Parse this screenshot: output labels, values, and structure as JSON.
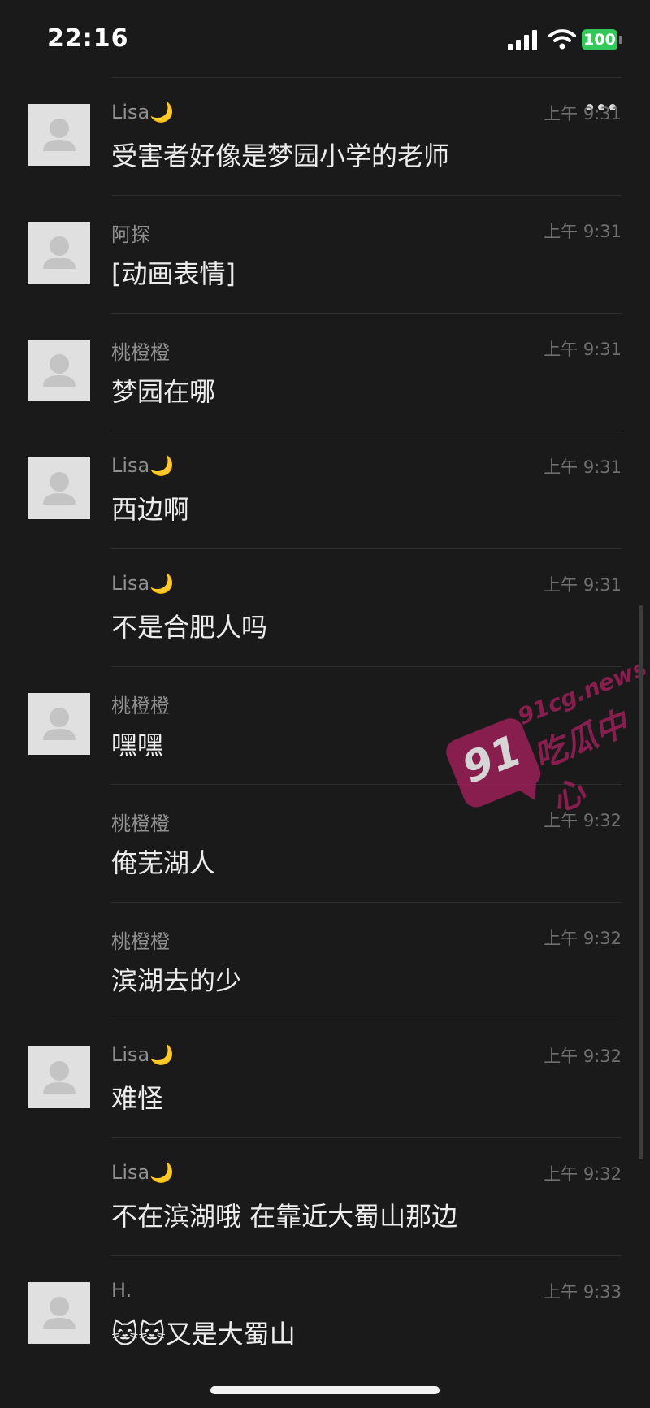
{
  "status_bar": {
    "time": "22:16",
    "battery": "100"
  },
  "chat": {
    "messages": [
      {
        "name": "Lisa🌙",
        "time": "上午 9:31",
        "text": "受害者好像是梦园小学的老师",
        "avatar": true
      },
      {
        "name": "阿探",
        "time": "上午 9:31",
        "text": "[动画表情]",
        "avatar": true
      },
      {
        "name": "桃橙橙",
        "time": "上午 9:31",
        "text": "梦园在哪",
        "avatar": true
      },
      {
        "name": "Lisa🌙",
        "time": "上午 9:31",
        "text": "西边啊",
        "avatar": true
      },
      {
        "name": "Lisa🌙",
        "time": "上午 9:31",
        "text": "不是合肥人吗",
        "avatar": false
      },
      {
        "name": "桃橙橙",
        "time": "",
        "text": "嘿嘿",
        "avatar": true
      },
      {
        "name": "桃橙橙",
        "time": "上午 9:32",
        "text": "俺芜湖人",
        "avatar": false
      },
      {
        "name": "桃橙橙",
        "time": "上午 9:32",
        "text": "滨湖去的少",
        "avatar": false
      },
      {
        "name": "Lisa🌙",
        "time": "上午 9:32",
        "text": "难怪",
        "avatar": true
      },
      {
        "name": "Lisa🌙",
        "time": "上午 9:32",
        "text": "不在滨湖哦 在靠近大蜀山那边",
        "avatar": false
      },
      {
        "name": "H.",
        "time": "上午 9:33",
        "text": "🐱🐱又是大蜀山",
        "avatar": true
      }
    ]
  },
  "watermark": {
    "number": "91",
    "site": "91cg.news",
    "name": "吃瓜中心"
  }
}
